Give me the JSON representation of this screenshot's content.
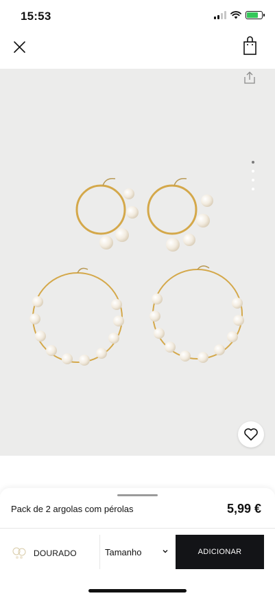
{
  "status_bar": {
    "time": "15:53"
  },
  "nav": {
    "close_icon": "close-icon",
    "bag_icon": "shopping-bag-icon"
  },
  "product_image": {
    "alt": "Pack de 2 argolas com pérolas",
    "page_count": 4,
    "active_page": 1,
    "background_color": "#ececeb"
  },
  "product": {
    "name": "Pack de 2 argolas com pérolas",
    "price": "5,99 €"
  },
  "actions": {
    "color_label": "DOURADO",
    "size_label": "Tamanho",
    "add_button_label": "ADICIONAR"
  },
  "colors": {
    "add_button_bg": "#131417",
    "battery": "#34c759"
  }
}
